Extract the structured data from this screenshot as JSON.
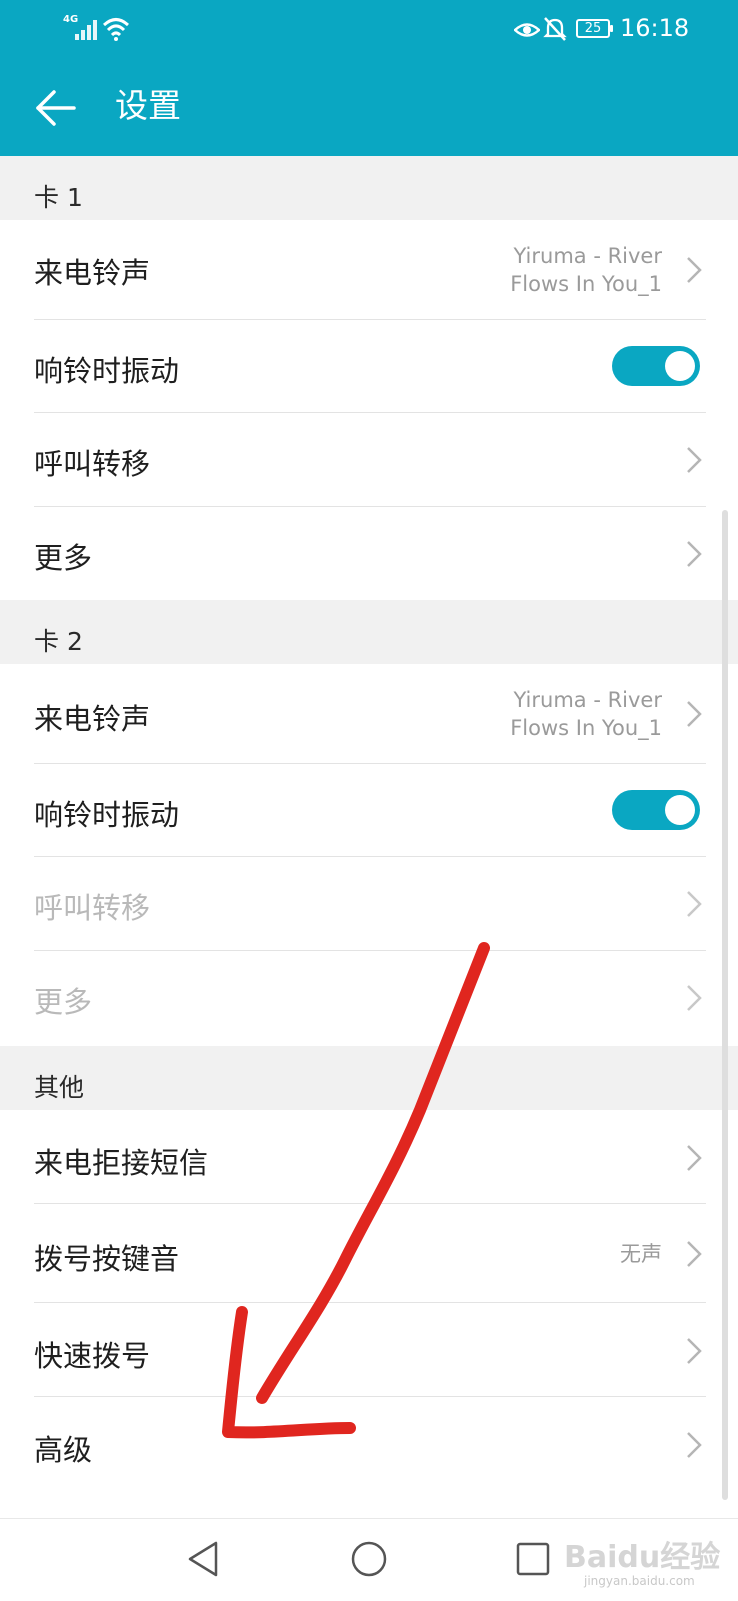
{
  "status_bar": {
    "network": "4G",
    "battery": "25",
    "time": "16:18",
    "icons": [
      "signal-icon",
      "wifi-icon",
      "eye-icon",
      "mute-icon",
      "battery-icon"
    ]
  },
  "app_bar": {
    "title": "设置",
    "back_icon": "back-arrow-icon",
    "color": "#0aa7c2"
  },
  "sim1": {
    "header": "卡 1",
    "ringtone_label": "来电铃声",
    "ringtone_value_line1": "Yiruma - River",
    "ringtone_value_line2": "Flows In You_1",
    "vibrate_label": "响铃时振动",
    "vibrate_on": true,
    "forwarding_label": "呼叫转移",
    "more_label": "更多"
  },
  "sim2": {
    "header": "卡 2",
    "ringtone_label": "来电铃声",
    "ringtone_value_line1": "Yiruma - River",
    "ringtone_value_line2": "Flows In You_1",
    "vibrate_label": "响铃时振动",
    "vibrate_on": true,
    "forwarding_label": "呼叫转移",
    "more_label": "更多"
  },
  "other": {
    "header": "其他",
    "reject_sms_label": "来电拒接短信",
    "dial_tone_label": "拨号按键音",
    "dial_tone_value": "无声",
    "speed_dial_label": "快速拨号",
    "advanced_label": "高级"
  },
  "watermark": {
    "text": "Baidu经验",
    "sub": "jingyan.baidu.com"
  },
  "colors": {
    "accent": "#0aa7c2",
    "annotation_arrow": "#e0261f",
    "section_bg": "#f1f1f1"
  }
}
